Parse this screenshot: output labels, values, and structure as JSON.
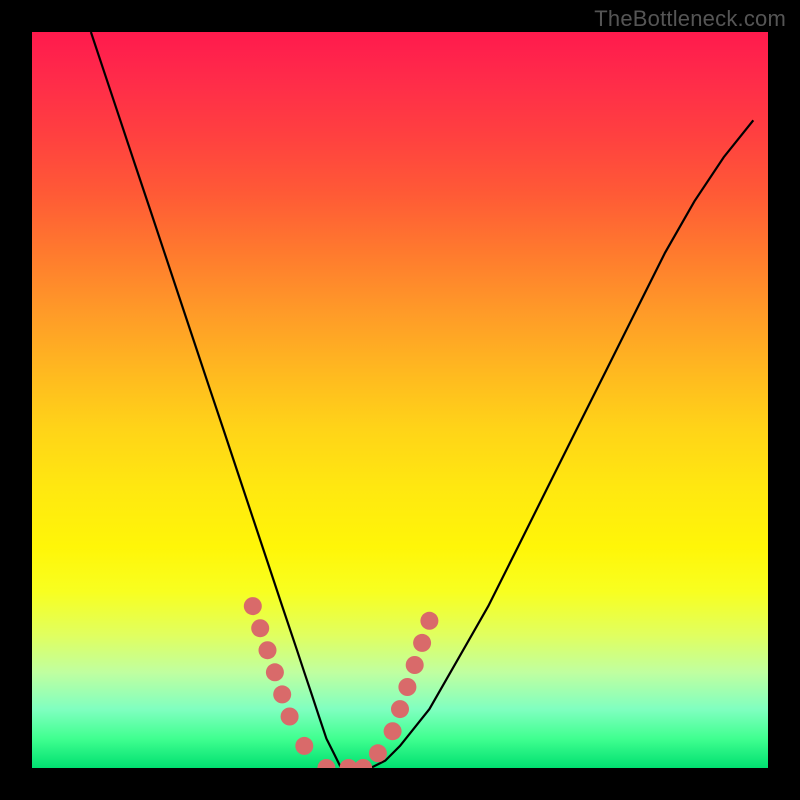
{
  "watermark": "TheBottleneck.com",
  "chart_data": {
    "type": "line",
    "title": "",
    "xlabel": "",
    "ylabel": "",
    "xlim": [
      0,
      100
    ],
    "ylim": [
      0,
      100
    ],
    "series": [
      {
        "name": "bottleneck-curve",
        "color": "#000000",
        "x": [
          8,
          10,
          12,
          14,
          16,
          18,
          20,
          22,
          24,
          26,
          28,
          30,
          32,
          34,
          36,
          37,
          38,
          39,
          40,
          41,
          42,
          44,
          46,
          48,
          50,
          54,
          58,
          62,
          66,
          70,
          74,
          78,
          82,
          86,
          90,
          94,
          98
        ],
        "y": [
          100,
          94,
          88,
          82,
          76,
          70,
          64,
          58,
          52,
          46,
          40,
          34,
          28,
          22,
          16,
          13,
          10,
          7,
          4,
          2,
          0,
          0,
          0,
          1,
          3,
          8,
          15,
          22,
          30,
          38,
          46,
          54,
          62,
          70,
          77,
          83,
          88
        ]
      }
    ],
    "markers": {
      "name": "highlight-dots",
      "color": "#d96a6a",
      "x": [
        30,
        31,
        32,
        33,
        34,
        35,
        37,
        40,
        43,
        45,
        47,
        49,
        50,
        51,
        52,
        53,
        54
      ],
      "y": [
        22,
        19,
        16,
        13,
        10,
        7,
        3,
        0,
        0,
        0,
        2,
        5,
        8,
        11,
        14,
        17,
        20
      ]
    },
    "background_gradient": {
      "top": "#ff1a4d",
      "bottom": "#00e070"
    }
  }
}
